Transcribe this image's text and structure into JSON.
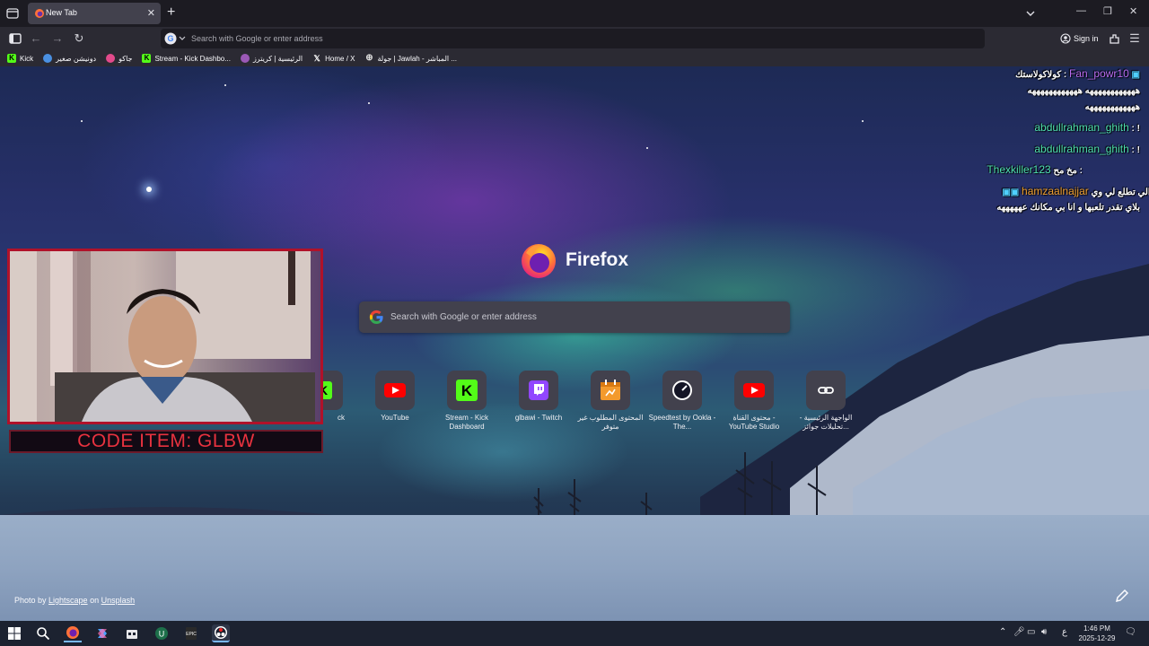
{
  "browser": {
    "tab": {
      "title": "New Tab"
    },
    "urlbar": {
      "placeholder": "Search with Google or enter address"
    },
    "signin_label": "Sign in"
  },
  "bookmarks": [
    {
      "label": "Kick",
      "icon": "kick-icon",
      "color": "#53fc18"
    },
    {
      "label": "دونيشن صغير",
      "icon": "donation-icon",
      "color": "#4a90e2"
    },
    {
      "label": "جاكو",
      "icon": "jaco-icon",
      "color": "#e24a8b"
    },
    {
      "label": "Stream - Kick Dashbo...",
      "icon": "kick-icon",
      "color": "#53fc18"
    },
    {
      "label": "الرئيسية | كريترز",
      "icon": "critters-icon",
      "color": "#9b59b6"
    },
    {
      "label": "Home / X",
      "icon": "x-icon",
      "color": "#ffffff"
    },
    {
      "label": "جولة | Jawlah - المباشر ...",
      "icon": "globe-icon",
      "color": "#cccccc"
    }
  ],
  "newtab": {
    "brand_name": "Firefox",
    "search_placeholder": "Search with Google or enter address",
    "top_sites": [
      {
        "label": "ck",
        "icon": "kick-icon"
      },
      {
        "label": "YouTube",
        "icon": "youtube-icon"
      },
      {
        "label": "Stream - Kick Dashboard",
        "icon": "kick-icon"
      },
      {
        "label": "glbawi - Twitch",
        "icon": "twitch-icon"
      },
      {
        "label": "المحتوى المطلوب غير متوفر",
        "icon": "calendar-icon"
      },
      {
        "label": "Speedtest by Ookla - The...",
        "icon": "speedtest-icon"
      },
      {
        "label": "محتوى القناة - YouTube Studio",
        "icon": "youtube-icon"
      },
      {
        "label": "الواجهة الرئيسية - تحليلات جوائز...",
        "icon": "link-icon"
      }
    ],
    "photo_credit": {
      "prefix": "Photo by ",
      "author": "Lightscape",
      "middle": " on ",
      "source": "Unsplash"
    }
  },
  "overlay": {
    "chat": [
      {
        "user": "Fan_powr10",
        "text": "كولاكولاستك :",
        "user_color": "#b86cf0"
      },
      {
        "user": "",
        "text": "ههههههههههههه ههههههههههههه",
        "user_color": "#ffffff"
      },
      {
        "user": "",
        "text": "ههههههههههههه",
        "user_color": "#ffffff"
      },
      {
        "user": "abdullrahman_ghith",
        "text": ": !",
        "user_color": "#4fe0b0"
      },
      {
        "user": "abdullrahman_ghith",
        "text": ": !",
        "user_color": "#4fe0b0"
      },
      {
        "user": "Thexkiller123",
        "text": "مخ مح :",
        "user_color": "#4fe0b0"
      },
      {
        "user": "hamzaalnajjar",
        "text": "ت الي تطلع لي وي :",
        "user_color": "#f0a030"
      },
      {
        "user": "",
        "text": "بلاي تقدر تلعبها و انا بي مكانك عهههههه",
        "user_color": "#ffffff"
      }
    ],
    "code_item": "CODE ITEM: GLBW"
  },
  "taskbar": {
    "language": "ع",
    "time": "1:46 PM",
    "date": "2025-12-29"
  }
}
